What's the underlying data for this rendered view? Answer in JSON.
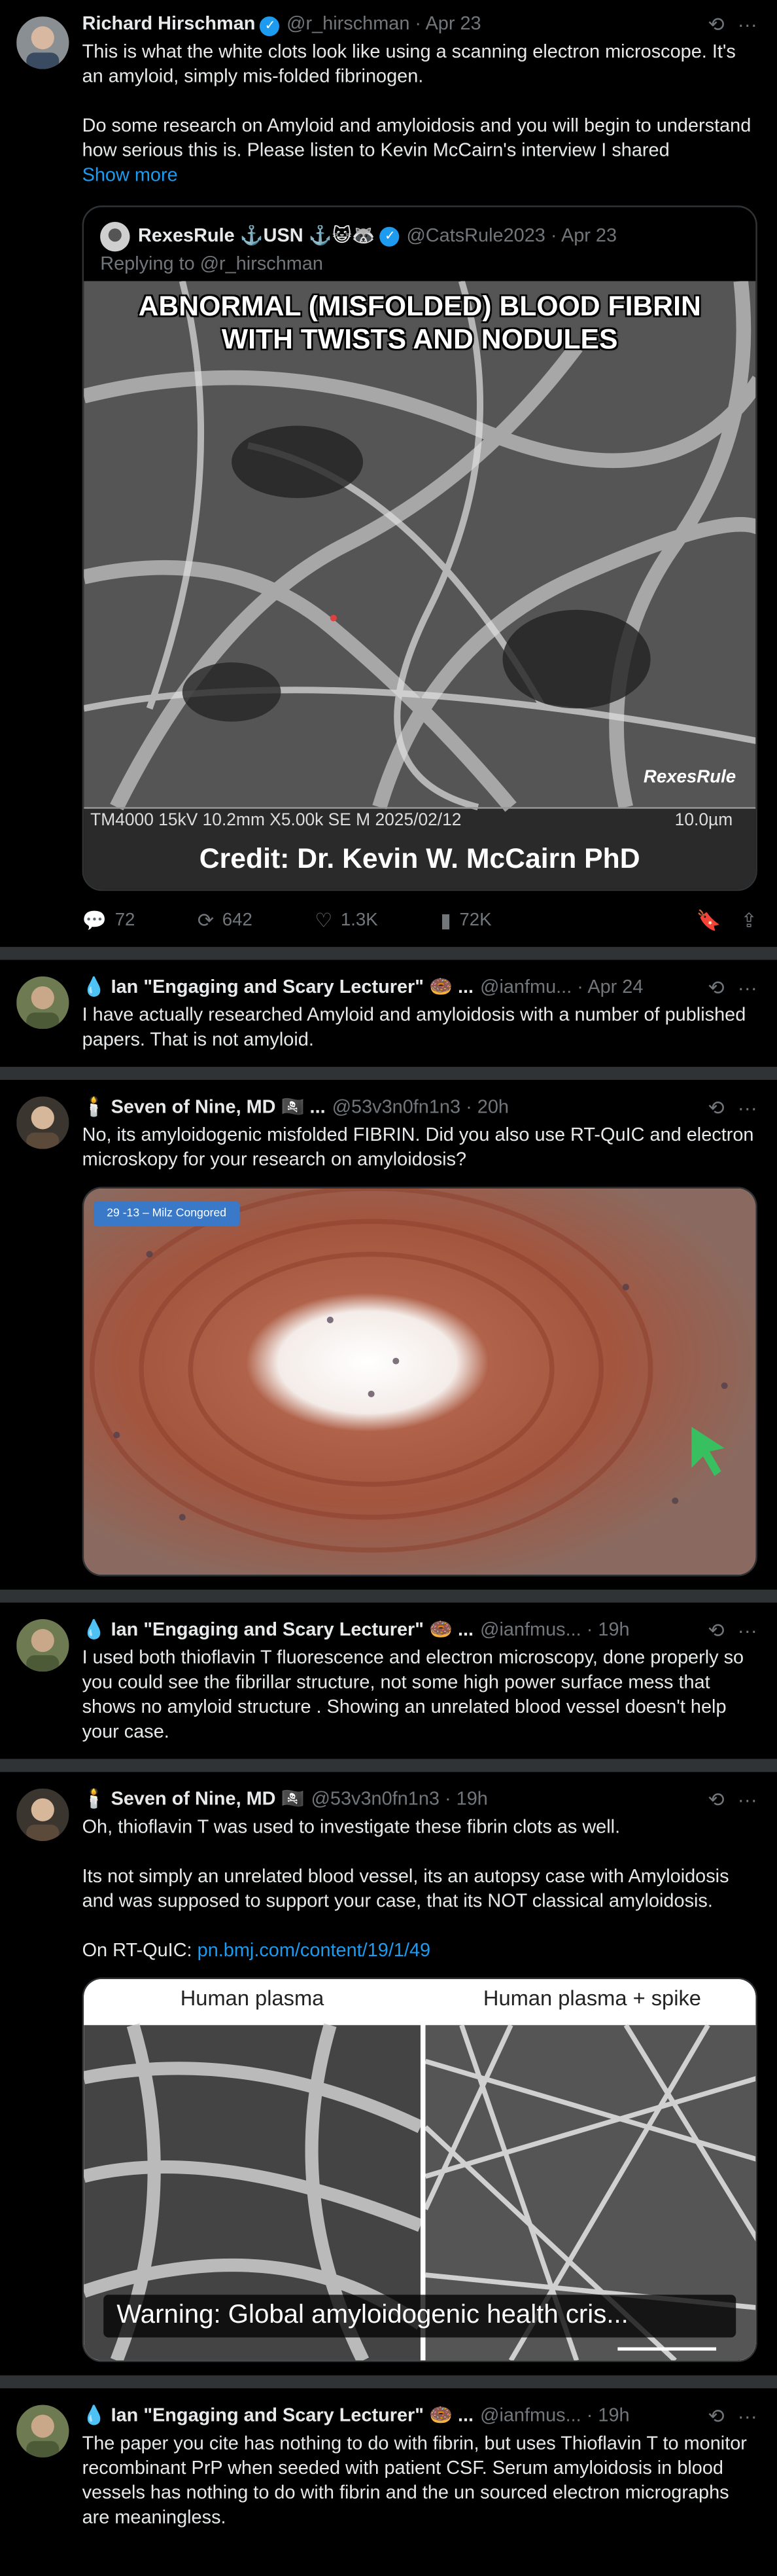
{
  "posts": [
    {
      "name": "Richard Hirschman",
      "verified": true,
      "handle": "@r_hirschman",
      "date": "Apr 23",
      "text": "This is what the white clots look like using a scanning electron microscope. It's an amyloid, simply mis-folded fibrinogen.\n\nDo some research on Amyloid and amyloidosis and you will begin to understand how serious this is. Please listen to Kevin McCairn's interview I shared",
      "show_more": "Show more",
      "quote": {
        "name": "RexesRule ⚓️USN ⚓️😺🦝",
        "handle": "@CatsRule2023",
        "date": "Apr 23",
        "replying_to": "Replying to @r_hirschman",
        "image_title_line1": "ABNORMAL (MISFOLDED) BLOOD FIBRIN",
        "image_title_line2": "WITH TWISTS AND NODULES",
        "image_watermark": "RexesRule",
        "sem_info": "TM4000 15kV 10.2mm X5.00k SE M 2025/02/12",
        "sem_scale": "10.0µm",
        "credit": "Credit:  Dr. Kevin W. McCairn PhD"
      },
      "stats": {
        "replies": "72",
        "reposts": "642",
        "likes": "1.3K",
        "views": "72K"
      }
    },
    {
      "name": "💧 Ian \"Engaging and Scary Lecturer\" 🍩 ...",
      "handle": "@ianfmu...",
      "date": "Apr 24",
      "text": "I have actually researched Amyloid and amyloidosis with a number of published papers. That is not amyloid."
    },
    {
      "name": "🕯️ Seven of Nine, MD 🏴‍☠️ ...",
      "handle": "@53v3n0fn1n3",
      "date": "20h",
      "text": "No, its amyloidogenic misfolded FIBRIN. Did you also use RT-QuIC and electron microskopy for your research on amyloidosis?",
      "image_label": "29 -13 – Milz Congored"
    },
    {
      "name": "💧 Ian \"Engaging and Scary Lecturer\" 🍩 ...",
      "handle": "@ianfmus...",
      "date": "19h",
      "text": "I used both thioflavin T fluorescence and electron microscopy, done properly so you could see the fibrillar structure, not some high power surface mess that shows no amyloid structure . Showing an unrelated blood vessel doesn't help your case."
    },
    {
      "name": "🕯️ Seven of Nine, MD 🏴‍☠️",
      "handle": "@53v3n0fn1n3",
      "date": "19h",
      "text": "Oh, thioflavin T was used to investigate these fibrin clots as well.\n\nIts not simply an unrelated blood vessel, its an autopsy case with Amyloidosis and was supposed to support your case, that its NOT classical amyloidosis.\n\nOn RT-QuIC: ",
      "link": "pn.bmj.com/content/19/1/49",
      "image_left_label": "Human plasma",
      "image_right_label": "Human plasma + spike",
      "image_caption": "Warning: Global amyloidogenic health cris..."
    },
    {
      "name": "💧 Ian \"Engaging and Scary Lecturer\" 🍩 ...",
      "handle": "@ianfmus...",
      "date": "19h",
      "text": "The paper you cite has nothing to do with fibrin, but uses Thioflavin T to monitor recombinant PrP when seeded with patient CSF. Serum amyloidosis in blood vessels has nothing to do with fibrin and the un sourced electron micrographs are meaningless."
    }
  ],
  "icons": [
    "grok-icon",
    "more-icon",
    "reply-icon",
    "repost-icon",
    "like-icon",
    "views-icon",
    "bookmark-icon",
    "share-icon"
  ],
  "colors": {
    "background": "#000000",
    "text": "#e7e9ea",
    "muted": "#71767b",
    "link": "#1d9bf0",
    "separator": "#2f3336"
  }
}
